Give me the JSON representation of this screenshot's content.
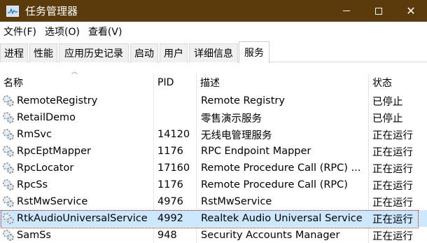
{
  "window": {
    "title": "任务管理器"
  },
  "menu": [
    "文件(F)",
    "选项(O)",
    "查看(V)"
  ],
  "tabs": [
    "进程",
    "性能",
    "应用历史记录",
    "启动",
    "用户",
    "详细信息",
    "服务"
  ],
  "active_tab": "服务",
  "table": {
    "columns": [
      "名称",
      "PID",
      "描述",
      "状态"
    ],
    "rows": [
      {
        "name": "RemoteRegistry",
        "pid": "",
        "desc": "Remote Registry",
        "status": "已停止"
      },
      {
        "name": "RetailDemo",
        "pid": "",
        "desc": "零售演示服务",
        "status": "已停止"
      },
      {
        "name": "RmSvc",
        "pid": "14120",
        "desc": "无线电管理服务",
        "status": "正在运行"
      },
      {
        "name": "RpcEptMapper",
        "pid": "1176",
        "desc": "RPC Endpoint Mapper",
        "status": "正在运行"
      },
      {
        "name": "RpcLocator",
        "pid": "17160",
        "desc": "Remote Procedure Call (RPC) ...",
        "status": "正在运行"
      },
      {
        "name": "RpcSs",
        "pid": "1176",
        "desc": "Remote Procedure Call (RPC)",
        "status": "正在运行"
      },
      {
        "name": "RstMwService",
        "pid": "4976",
        "desc": "RstMwService",
        "status": "正在运行"
      },
      {
        "name": "RtkAudioUniversalService",
        "pid": "4992",
        "desc": "Realtek Audio Universal Service",
        "status": "正在运行",
        "selected": true
      },
      {
        "name": "SamSs",
        "pid": "948",
        "desc": "Security Accounts Manager",
        "status": "正在运行"
      }
    ]
  }
}
